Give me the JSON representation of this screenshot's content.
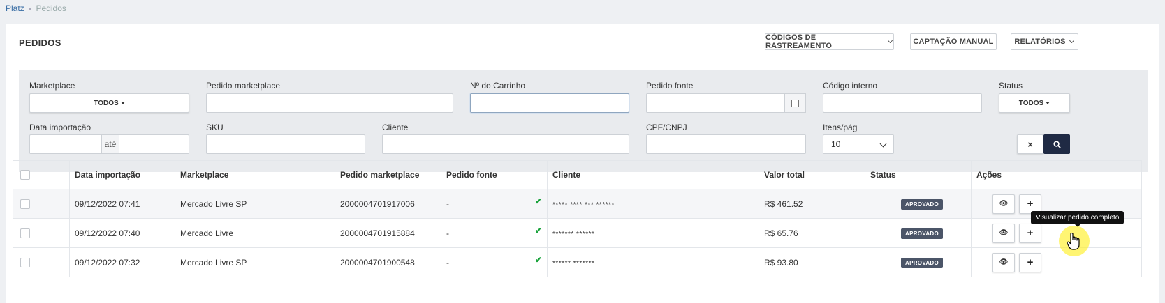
{
  "breadcrumb": {
    "root": "Platz",
    "current": "Pedidos"
  },
  "header": {
    "title": "PEDIDOS",
    "btn_rastreamento": "CÓDIGOS DE RASTREAMENTO",
    "btn_captacao": "CAPTAÇÃO MANUAL",
    "btn_relatorios": "RELATÓRIOS"
  },
  "filters": {
    "marketplace_label": "Marketplace",
    "marketplace_value": "TODOS",
    "pedido_marketplace_label": "Pedido marketplace",
    "pedido_marketplace_value": "",
    "carrinho_label": "Nº do Carrinho",
    "carrinho_value": "",
    "pedido_fonte_label": "Pedido fonte",
    "pedido_fonte_value": "",
    "codigo_interno_label": "Código interno",
    "codigo_interno_value": "",
    "status_label": "Status",
    "status_value": "TODOS",
    "data_label": "Data importação",
    "data_from": "",
    "data_sep": "até",
    "data_to": "",
    "sku_label": "SKU",
    "sku_value": "",
    "cliente_label": "Cliente",
    "cliente_value": "",
    "cpf_label": "CPF/CNPJ",
    "cpf_value": "",
    "itens_label": "Itens/pág",
    "itens_value": "10",
    "clear_icon": "×"
  },
  "table": {
    "columns": [
      "",
      "Data importação",
      "Marketplace",
      "Pedido marketplace",
      "Pedido fonte",
      "Cliente",
      "Valor total",
      "Status",
      "Ações"
    ],
    "rows": [
      {
        "data": "09/12/2022 07:41",
        "marketplace": "Mercado Livre SP",
        "pedido": "2000004701917006",
        "fonte": "-",
        "cliente": "***** **** *** ******",
        "valor": "R$ 461.52",
        "status": "APROVADO"
      },
      {
        "data": "09/12/2022 07:40",
        "marketplace": "Mercado Livre",
        "pedido": "2000004701915884",
        "fonte": "-",
        "cliente": "******* ******",
        "valor": "R$ 65.76",
        "status": "APROVADO"
      },
      {
        "data": "09/12/2022 07:32",
        "marketplace": "Mercado Livre SP",
        "pedido": "2000004701900548",
        "fonte": "-",
        "cliente": "****** *******",
        "valor": "R$ 93.80",
        "status": "APROVADO"
      }
    ]
  },
  "tooltip": "Visualizar pedido completo",
  "icons": {
    "check": "✔",
    "eye": "👁",
    "plus": "+"
  },
  "colors": {
    "primary_dark": "#1f2a44",
    "badge": "#4b5568",
    "link": "#3a6ea5",
    "check_green": "#1aa33c"
  }
}
